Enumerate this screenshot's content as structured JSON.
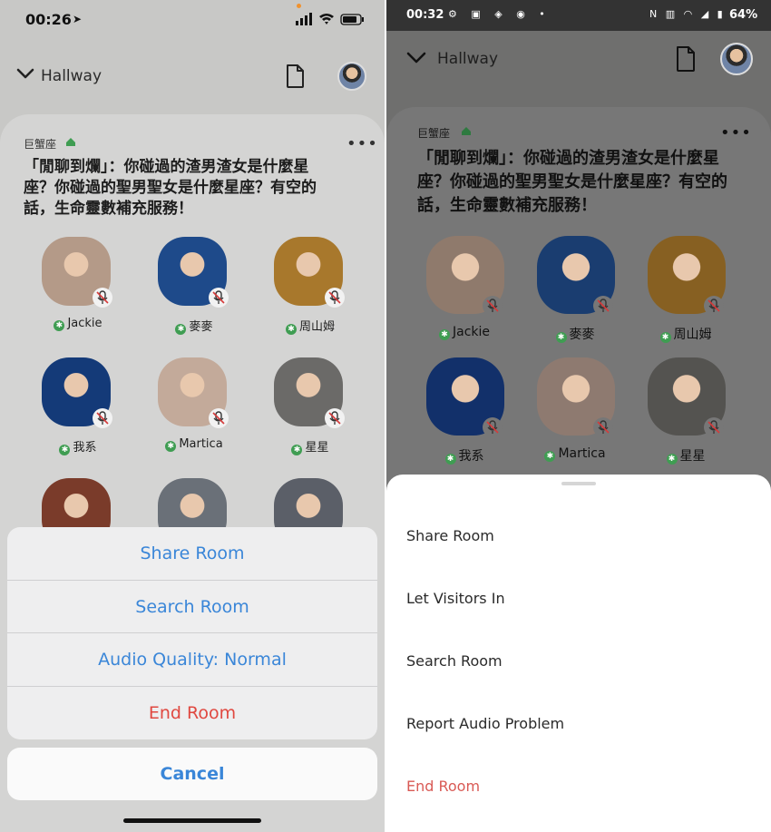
{
  "ios": {
    "status": {
      "time": "00:26",
      "location_icon": "location-arrow-icon"
    },
    "nav": {
      "back_label": "Hallway"
    },
    "room": {
      "club": "巨蟹座",
      "more": "•••",
      "title": "「閒聊到爛」：你碰過的渣男渣女是什麼星座？你碰過的聖男聖女是什麼星座？有空的話，生命靈數補充服務！"
    },
    "speakers": [
      {
        "name": "Jackie",
        "color": "#b49a88"
      },
      {
        "name": "麥麥",
        "color": "#1e4a8a"
      },
      {
        "name": "周山姆",
        "color": "#a8782c"
      },
      {
        "name": "我系",
        "color": "#143a78"
      },
      {
        "name": "Martica",
        "color": "#c3aa9a"
      },
      {
        "name": "星星",
        "color": "#6b6a68"
      },
      {
        "name": "",
        "color": "#7a3b2a"
      },
      {
        "name": "",
        "color": "#6a7078"
      },
      {
        "name": "",
        "color": "#5b5f68"
      }
    ],
    "sheet": {
      "items": [
        "Share Room",
        "Search Room",
        "Audio Quality: Normal",
        "End Room"
      ],
      "cancel": "Cancel"
    }
  },
  "android": {
    "status": {
      "time": "00:32",
      "battery": "64%"
    },
    "nav": {
      "back_label": "Hallway"
    },
    "room": {
      "club": "巨蟹座",
      "more": "•••",
      "title": "「閒聊到爛」：你碰過的渣男渣女是什麼星座？你碰過的聖男聖女是什麼星座？有空的話，生命靈數補充服務！"
    },
    "speakers": [
      {
        "name": "Jackie",
        "color": "#8f7a6c"
      },
      {
        "name": "麥麥",
        "color": "#1a3d70"
      },
      {
        "name": "周山姆",
        "color": "#876022"
      },
      {
        "name": "我系",
        "color": "#12306a"
      },
      {
        "name": "Martica",
        "color": "#8e7a70"
      },
      {
        "name": "星星",
        "color": "#545350"
      }
    ],
    "sheet": {
      "items": [
        "Share Room",
        "Let Visitors In",
        "Search Room",
        "Report Audio Problem",
        "End Room"
      ]
    }
  },
  "colors": {
    "ios_action": "#3a86d8",
    "danger": "#e04840",
    "club_green": "#3f9d52"
  }
}
